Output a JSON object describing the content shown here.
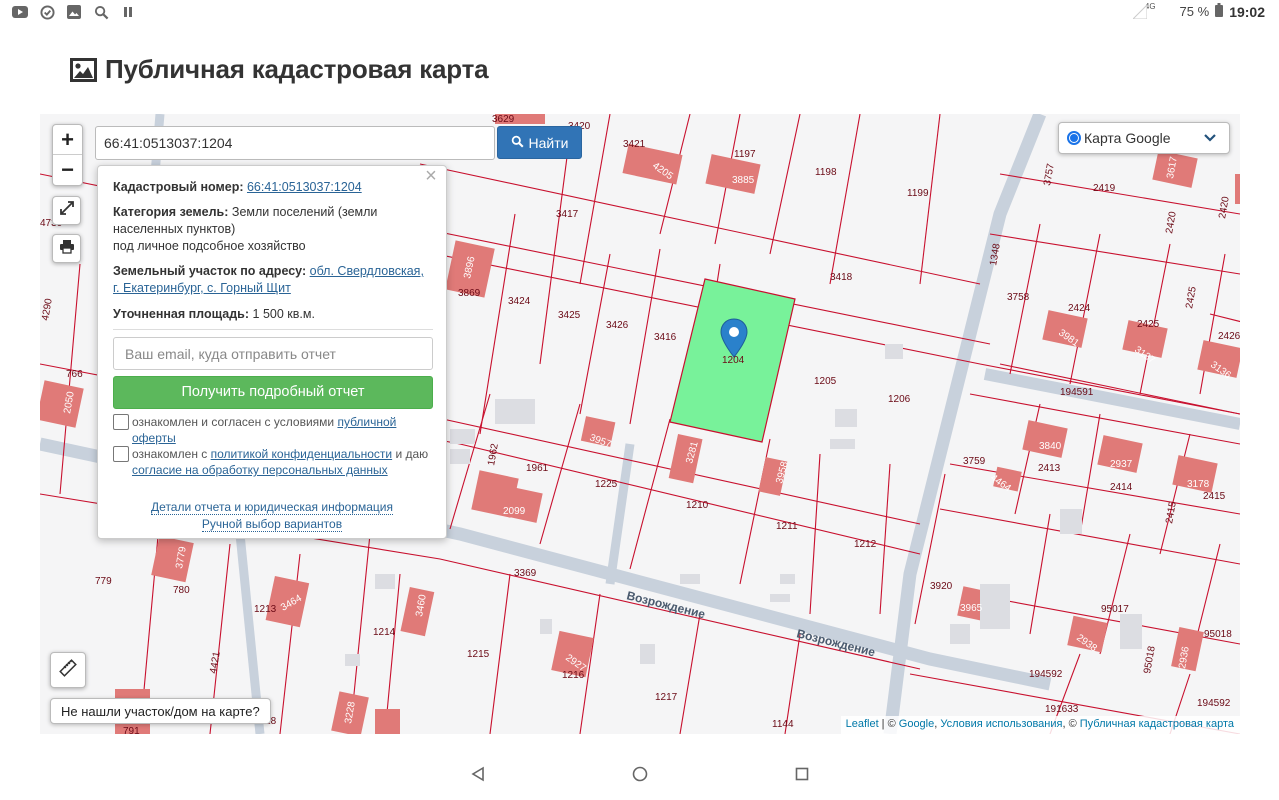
{
  "status_bar": {
    "network": "4G",
    "battery": "75 %",
    "time": "19:02",
    "icons": [
      "youtube-icon",
      "check-circle-icon",
      "image-icon",
      "search-icon",
      "pause-icon"
    ]
  },
  "page": {
    "title": "Публичная кадастровая карта"
  },
  "search": {
    "value": "66:41:0513037:1204",
    "button_label": "Найти"
  },
  "layer_selector": {
    "label": "Карта Google"
  },
  "popup": {
    "cadastral_label": "Кадастровый номер:",
    "cadastral_value": "66:41:0513037:1204",
    "category_label": "Категория земель:",
    "category_value": "Земли поселений (земли населенных пунктов)",
    "category_use": "под личное подсобное хозяйство",
    "address_label": "Земельный участок по адресу:",
    "address_value": "обл. Свердловская, г. Екатеринбург, с. Горный Щит",
    "area_label": "Уточненная площадь:",
    "area_value": "1 500 кв.м.",
    "email_placeholder": "Ваш email, куда отправить отчет",
    "report_button": "Получить подробный отчет",
    "agree1_text": "ознакомлен и согласен с условиями",
    "agree1_link": "публичной оферты",
    "agree2_text_a": "ознакомлен с",
    "agree2_link_a": "политикой конфиденциальности",
    "agree2_text_b": "и даю",
    "agree2_link_b": "согласие на обработку персональных данных",
    "details_link": "Детали отчета и юридическая информация",
    "manual_link": "Ручной выбор вариантов"
  },
  "map_controls": {
    "zoom_in": "+",
    "zoom_out": "−",
    "not_found_label": "Не нашли участок/дом на карте?"
  },
  "attribution": {
    "leaflet": "Leaflet",
    "sep1": " | © ",
    "google": "Google",
    "sep2": ", ",
    "terms": "Условия использования",
    "sep3": ", © ",
    "pkk": "Публичная кадастровая карта"
  },
  "parcels": {
    "selected_label": "1204",
    "street_name": "Возрождение",
    "labels": [
      "3629",
      "3420",
      "3421",
      "4205",
      "1197",
      "3885",
      "1198",
      "1199",
      "3757",
      "2419",
      "3617",
      "2420",
      "2420",
      "4730",
      "3417",
      "3418",
      "1348",
      "3896",
      "3869",
      "3424",
      "3425",
      "3426",
      "3416",
      "1205",
      "1206",
      "3758",
      "2424",
      "3981",
      "2425",
      "3137",
      "2425",
      "2426",
      "3136",
      "194591",
      "4290",
      "766",
      "2050",
      "3957",
      "3281",
      "3958",
      "1962",
      "1961",
      "1225",
      "1210",
      "1211",
      "1212",
      "3759",
      "2413",
      "3840",
      "2937",
      "2414",
      "3178",
      "2415",
      "4464",
      "2415",
      "2099",
      "3779",
      "779",
      "780",
      "3369",
      "3920",
      "3965",
      "95017",
      "2938",
      "95018",
      "95018",
      "2936",
      "1213",
      "3464",
      "3460",
      "1214",
      "1215",
      "2927",
      "1216",
      "1217",
      "4421",
      "3228",
      "194592",
      "194592",
      "191633",
      "1144",
      "791",
      "1218"
    ]
  }
}
